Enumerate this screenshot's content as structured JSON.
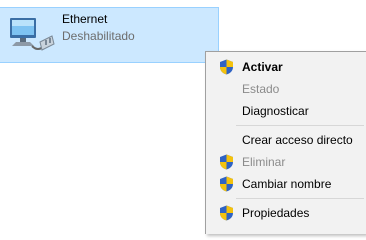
{
  "network_item": {
    "name": "Ethernet",
    "status": "Deshabilitado",
    "icon": "network-adapter-icon"
  },
  "context_menu": {
    "items": [
      {
        "label": "Activar",
        "icon": "uac-shield-icon",
        "bold": true,
        "enabled": true
      },
      {
        "label": "Estado",
        "icon": null,
        "bold": false,
        "enabled": false
      },
      {
        "label": "Diagnosticar",
        "icon": null,
        "bold": false,
        "enabled": true
      },
      {
        "label": "Crear acceso directo",
        "icon": null,
        "bold": false,
        "enabled": true
      },
      {
        "label": "Eliminar",
        "icon": "uac-shield-icon",
        "bold": false,
        "enabled": false
      },
      {
        "label": "Cambiar nombre",
        "icon": "uac-shield-icon",
        "bold": false,
        "enabled": true
      },
      {
        "label": "Propiedades",
        "icon": "uac-shield-icon",
        "bold": false,
        "enabled": true
      }
    ]
  },
  "colors": {
    "selection_bg": "#cce8ff",
    "menu_bg": "#f2f2f2",
    "disabled_text": "#8b8b8b"
  }
}
